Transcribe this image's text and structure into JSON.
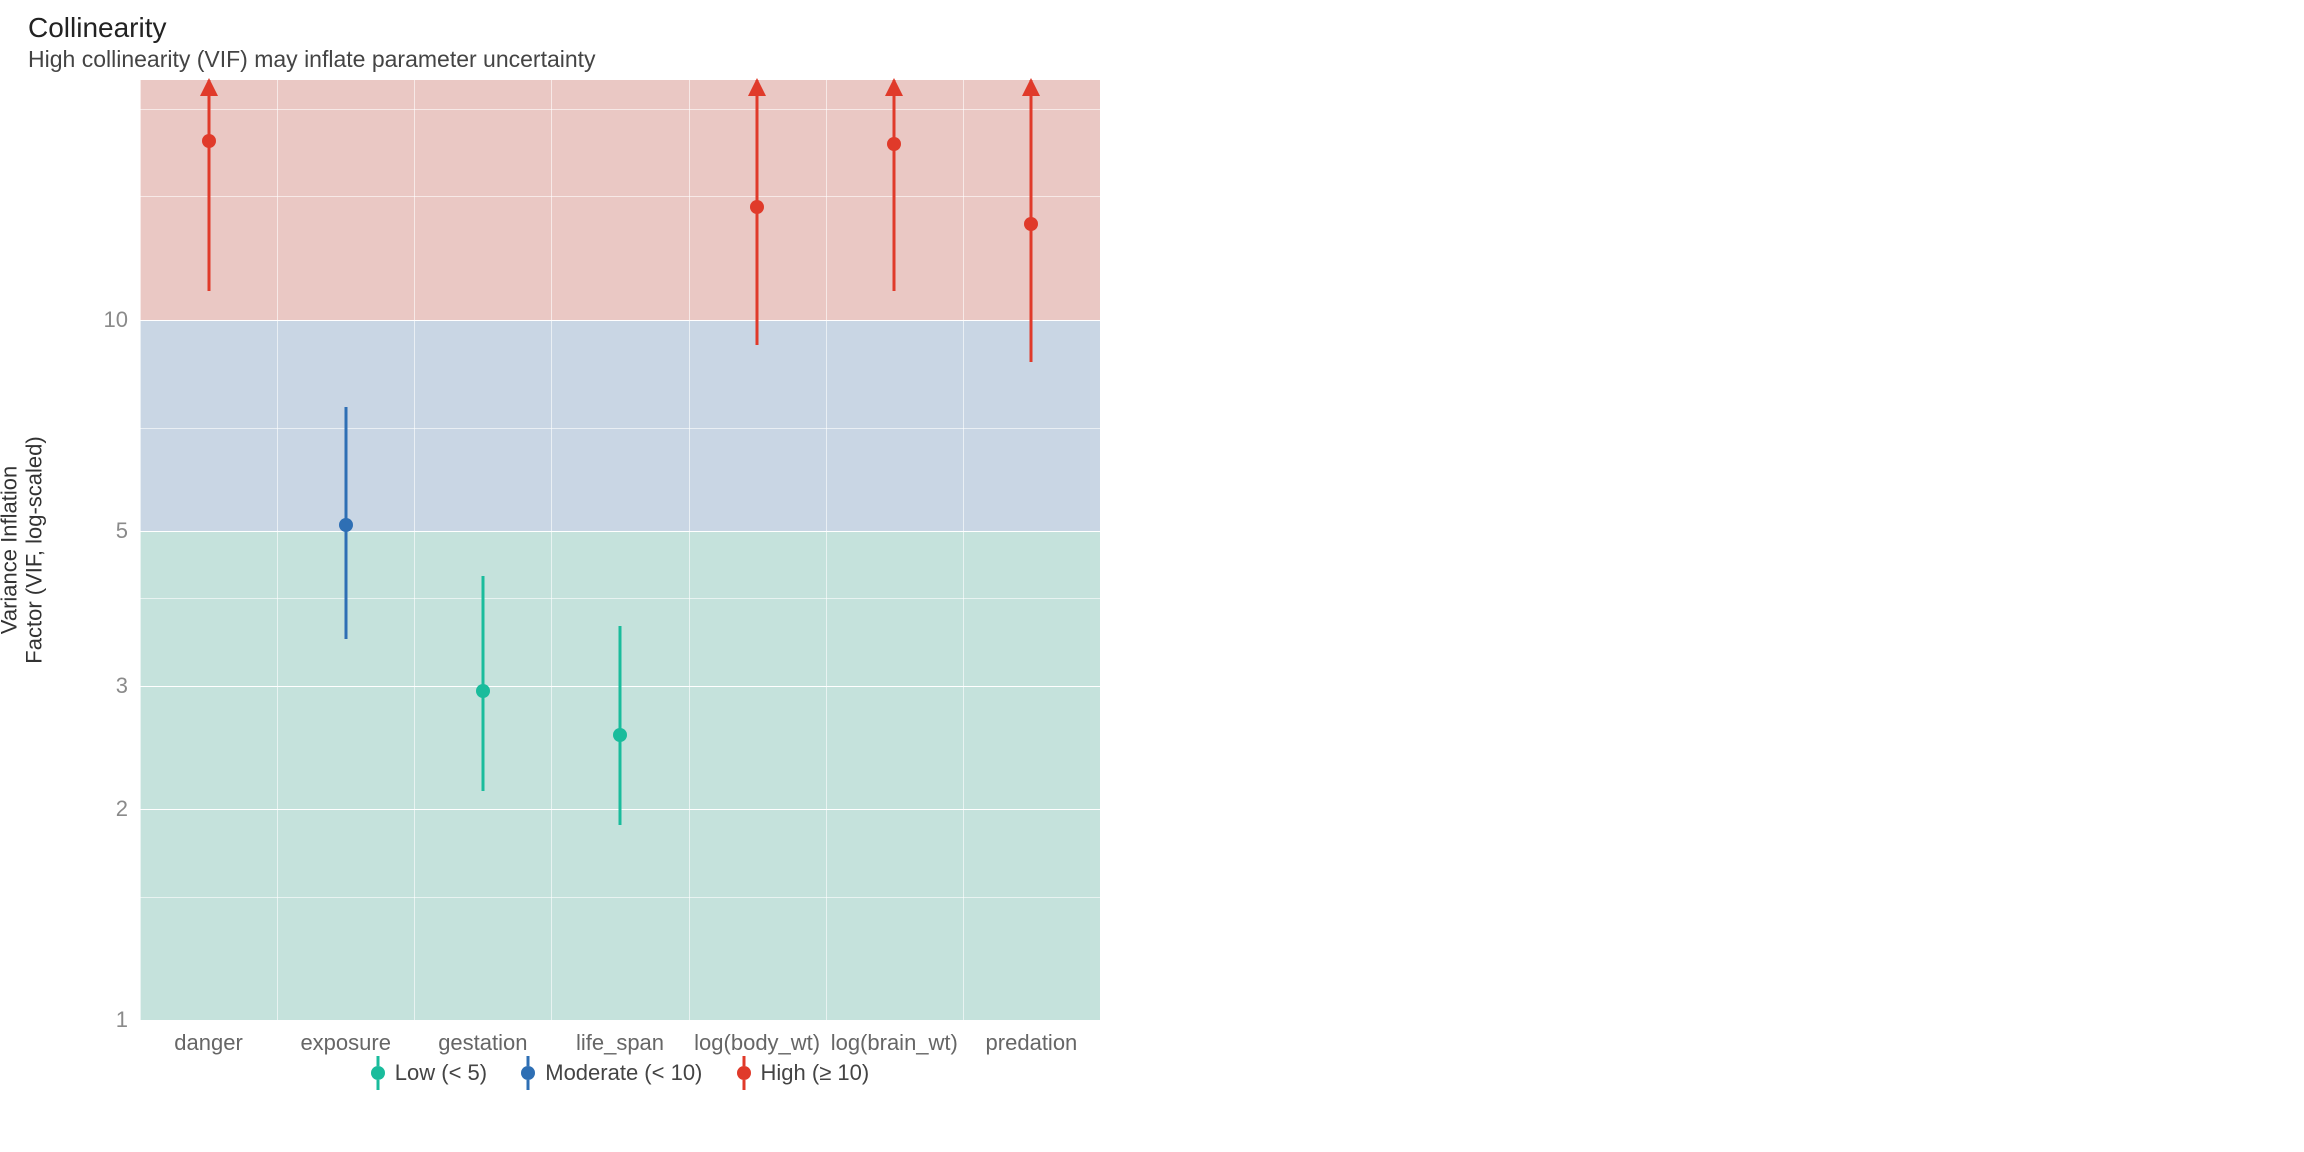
{
  "title": "Collinearity",
  "subtitle": "High collinearity (VIF) may inflate parameter uncertainty",
  "ylabel_line1": "Variance Inflation",
  "ylabel_line2": "Factor (VIF, log-scaled)",
  "legend": {
    "low": "Low (< 5)",
    "moderate": "Moderate (< 10)",
    "high": "High (≥ 10)"
  },
  "chart_data": {
    "type": "scatter",
    "title": "Collinearity",
    "subtitle": "High collinearity (VIF) may inflate parameter uncertainty",
    "xlabel": "",
    "ylabel": "Variance Inflation Factor (VIF, log-scaled)",
    "y_scale": "log",
    "y_ticks": [
      1,
      2,
      3,
      5,
      10
    ],
    "y_visible_max": 22,
    "bands": [
      {
        "name": "Low (< 5)",
        "from": 1,
        "to": 5,
        "color": "#1abc9c"
      },
      {
        "name": "Moderate (< 10)",
        "from": 5,
        "to": 10,
        "color": "#2e6fb4"
      },
      {
        "name": "High (≥ 10)",
        "from": 10,
        "to": 22,
        "color": "#e03a2a"
      }
    ],
    "categories": [
      "danger",
      "exposure",
      "gestation",
      "life_span",
      "log(body_wt)",
      "log(brain_wt)",
      "predation"
    ],
    "series": [
      {
        "name": "VIF",
        "points": [
          {
            "category": "danger",
            "vif": 18.0,
            "ci_low": 11.0,
            "ci_high": 30.0,
            "level": "high",
            "upper_truncated": true
          },
          {
            "category": "exposure",
            "vif": 5.1,
            "ci_low": 3.5,
            "ci_high": 7.5,
            "level": "moderate",
            "upper_truncated": false
          },
          {
            "category": "gestation",
            "vif": 2.95,
            "ci_low": 2.12,
            "ci_high": 4.3,
            "level": "low",
            "upper_truncated": false
          },
          {
            "category": "life_span",
            "vif": 2.55,
            "ci_low": 1.9,
            "ci_high": 3.65,
            "level": "low",
            "upper_truncated": false
          },
          {
            "category": "log(body_wt)",
            "vif": 14.5,
            "ci_low": 9.2,
            "ci_high": 23.0,
            "level": "high",
            "upper_truncated": true
          },
          {
            "category": "log(brain_wt)",
            "vif": 17.8,
            "ci_low": 11.0,
            "ci_high": 29.0,
            "level": "high",
            "upper_truncated": true
          },
          {
            "category": "predation",
            "vif": 13.7,
            "ci_low": 8.7,
            "ci_high": 22.0,
            "level": "high",
            "upper_truncated": true
          }
        ]
      }
    ],
    "legend_position": "bottom"
  }
}
